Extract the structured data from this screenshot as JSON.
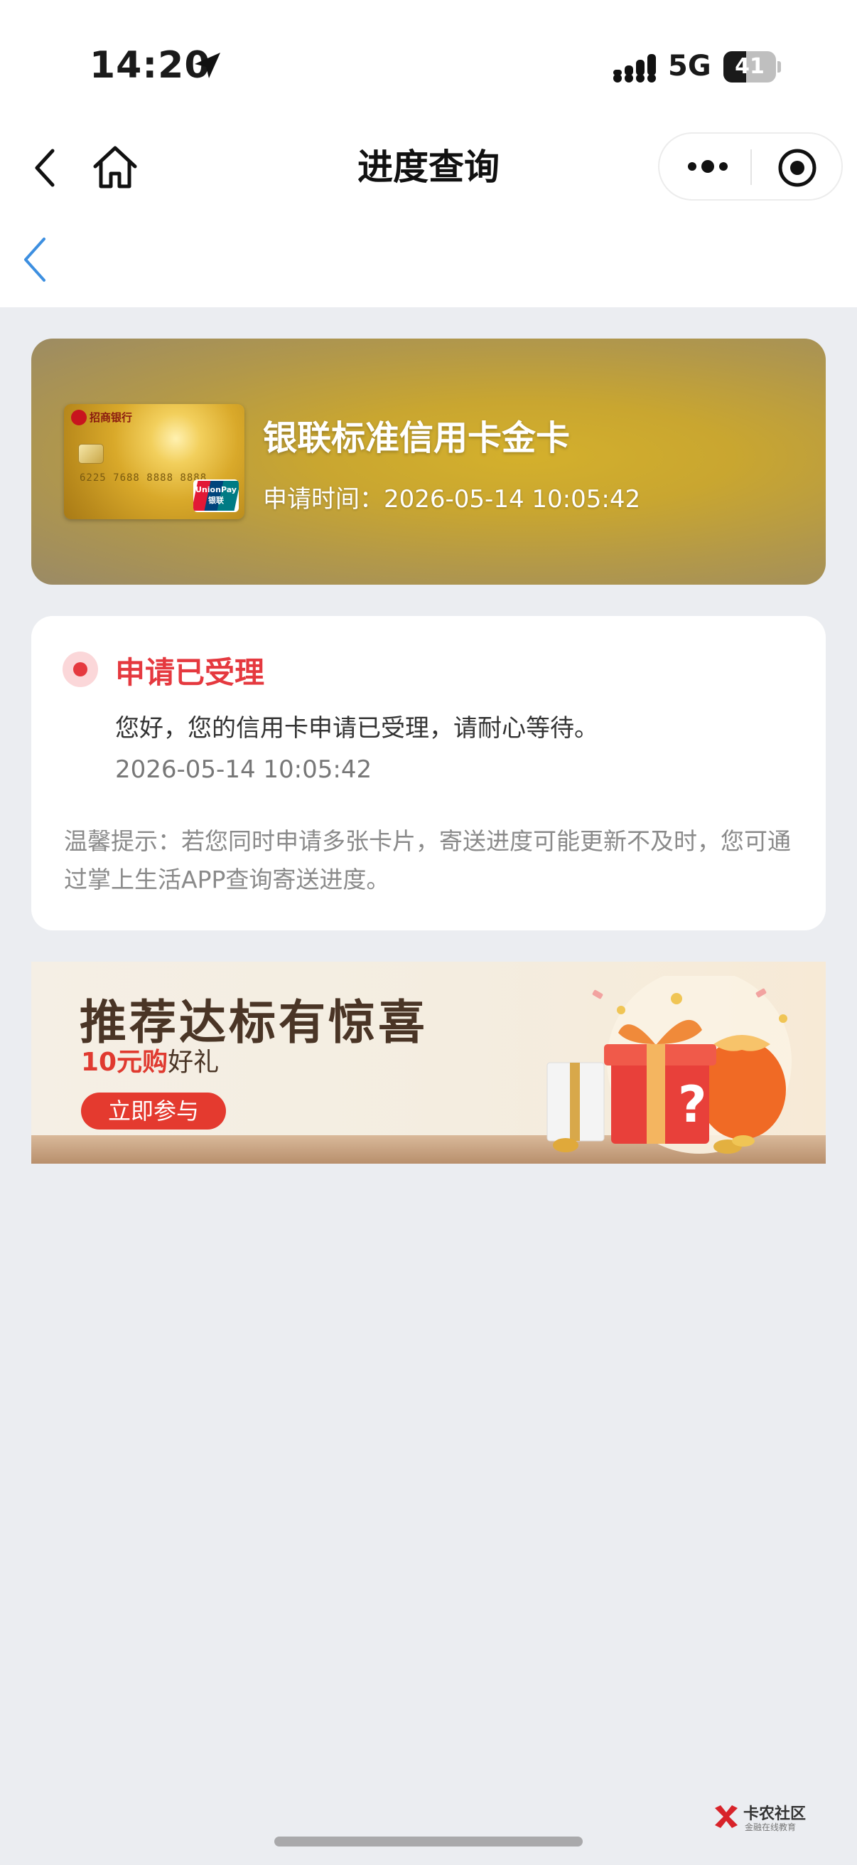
{
  "status_bar": {
    "time": "14:20",
    "network": "5G",
    "battery_level": "41"
  },
  "nav": {
    "title": "进度查询",
    "icons": [
      "back-icon",
      "home-icon",
      "more-icon",
      "close-mini-program-icon"
    ]
  },
  "card": {
    "name": "银联标准信用卡金卡",
    "apply_time": "申请时间：2026-05-14 10:05:42",
    "image_bank_name": "招商银行",
    "image_card_number": "6225 7688 8888 8888",
    "image_brand": "UnionPay 银联"
  },
  "status": {
    "title": "申请已受理",
    "message": "您好，您的信用卡申请已受理，请耐心等待。",
    "time": "2026-05-14 10:05:42",
    "tip": "温馨提示：若您同时申请多张卡片，寄送进度可能更新不及时，您可通过掌上生活APP查询寄送进度。"
  },
  "promo": {
    "title": "推荐达标有惊喜",
    "subtitle_red": "10元购",
    "subtitle_rest": "好礼",
    "button": "立即参与"
  },
  "watermark": {
    "title": "卡农社区",
    "subtitle": "金融在线教育"
  },
  "colors": {
    "accent_red": "#e5393f",
    "page_bg": "#ebedf1",
    "back_arrow_blue": "#3d8fe0"
  }
}
